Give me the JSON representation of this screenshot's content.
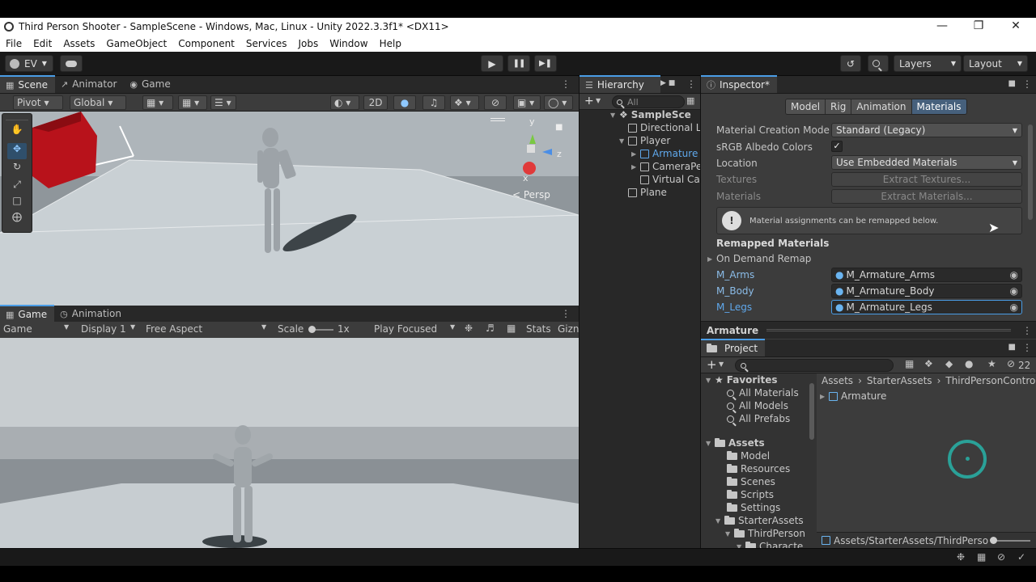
{
  "window": {
    "title": "Third Person Shooter - SampleScene - Windows, Mac, Linux - Unity 2022.3.3f1* <DX11>"
  },
  "menu": [
    "File",
    "Edit",
    "Assets",
    "GameObject",
    "Component",
    "Services",
    "Jobs",
    "Window",
    "Help"
  ],
  "toolbar": {
    "account": "EV",
    "layers": "Layers",
    "layout": "Layout"
  },
  "scene_panel": {
    "tabs": [
      "Scene",
      "Animator",
      "Game"
    ],
    "pivot": "Pivot",
    "global": "Global",
    "mode_2d": "2D",
    "persp_label": "< Persp",
    "gizmo_y": "y",
    "gizmo_z": "z",
    "gizmo_x": "x"
  },
  "game_panel": {
    "tabs": [
      "Game",
      "Animation"
    ],
    "display_mode": "Game",
    "display": "Display 1",
    "aspect": "Free Aspect",
    "scale_label": "Scale",
    "scale_value": "1x",
    "play_mode": "Play Focused",
    "stats": "Stats",
    "gizmos": "Gizn"
  },
  "hierarchy": {
    "tab": "Hierarchy",
    "search_placeholder": "All",
    "items": [
      {
        "label": "SampleSce",
        "indent": 0
      },
      {
        "label": "Directional L",
        "indent": 1
      },
      {
        "label": "Player",
        "indent": 1
      },
      {
        "label": "Armature",
        "indent": 2
      },
      {
        "label": "CameraPe",
        "indent": 2
      },
      {
        "label": "Virtual Ca",
        "indent": 2
      },
      {
        "label": "Plane",
        "indent": 1
      }
    ]
  },
  "inspector": {
    "tab": "Inspector*",
    "subtabs": [
      "Model",
      "Rig",
      "Animation",
      "Materials"
    ],
    "active_subtab": "Materials",
    "fields": {
      "creation_mode_label": "Material Creation Mode",
      "creation_mode_value": "Standard (Legacy)",
      "srgb_label": "sRGB Albedo Colors",
      "location_label": "Location",
      "location_value": "Use Embedded Materials",
      "textures_label": "Textures",
      "textures_button": "Extract Textures...",
      "materials_label": "Materials",
      "materials_button": "Extract Materials..."
    },
    "info_message": "Material assignments can be remapped below.",
    "remapped_header": "Remapped Materials",
    "on_demand": "On Demand Remap",
    "remaps": [
      {
        "name": "M_Arms",
        "value": "M_Armature_Arms"
      },
      {
        "name": "M_Body",
        "value": "M_Armature_Body"
      },
      {
        "name": "M_Legs",
        "value": "M_Armature_Legs"
      }
    ],
    "footer": "Armature"
  },
  "project": {
    "tab": "Project",
    "hidden_count": "22",
    "favorites": {
      "label": "Favorites",
      "items": [
        "All Materials",
        "All Models",
        "All Prefabs"
      ]
    },
    "assets": {
      "label": "Assets",
      "items": [
        "Model",
        "Resources",
        "Scenes",
        "Scripts",
        "Settings",
        "StarterAssets",
        "ThirdPerson",
        "Characte"
      ]
    },
    "breadcrumb": [
      "Assets",
      "StarterAssets",
      "ThirdPersonControlle"
    ],
    "files": [
      "Armature"
    ],
    "path": "Assets/StarterAssets/ThirdPerso"
  },
  "colors": {
    "accent": "#4a9de6",
    "selected": "#2c5d87",
    "link": "#5fa8ec"
  }
}
